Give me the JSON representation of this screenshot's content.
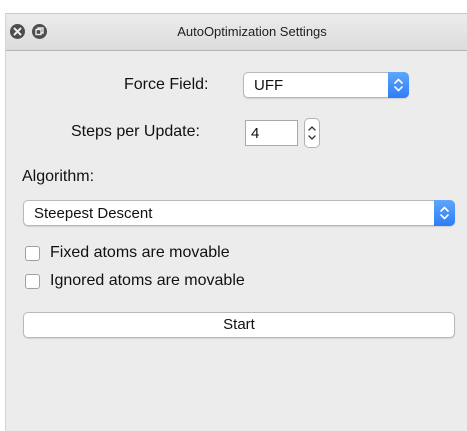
{
  "window": {
    "title": "AutoOptimization Settings",
    "close_icon": "close-icon",
    "zoom_icon": "zoom-icon"
  },
  "form": {
    "force_field": {
      "label": "Force Field:",
      "value": "UFF",
      "icon": "popup-updown-chevron-icon"
    },
    "steps_per_update": {
      "label": "Steps per Update:",
      "value": "4",
      "icon": "stepper-updown-icon"
    },
    "algorithm": {
      "label": "Algorithm:",
      "value": "Steepest Descent",
      "icon": "popup-updown-chevron-icon"
    },
    "fixed_atoms_movable": {
      "label": "Fixed atoms are movable",
      "checked": false
    },
    "ignored_atoms_movable": {
      "label": "Ignored atoms are movable",
      "checked": false
    },
    "start_button": "Start"
  },
  "colors": {
    "window_bg": "#ececec",
    "accent": "#3b87f7"
  }
}
